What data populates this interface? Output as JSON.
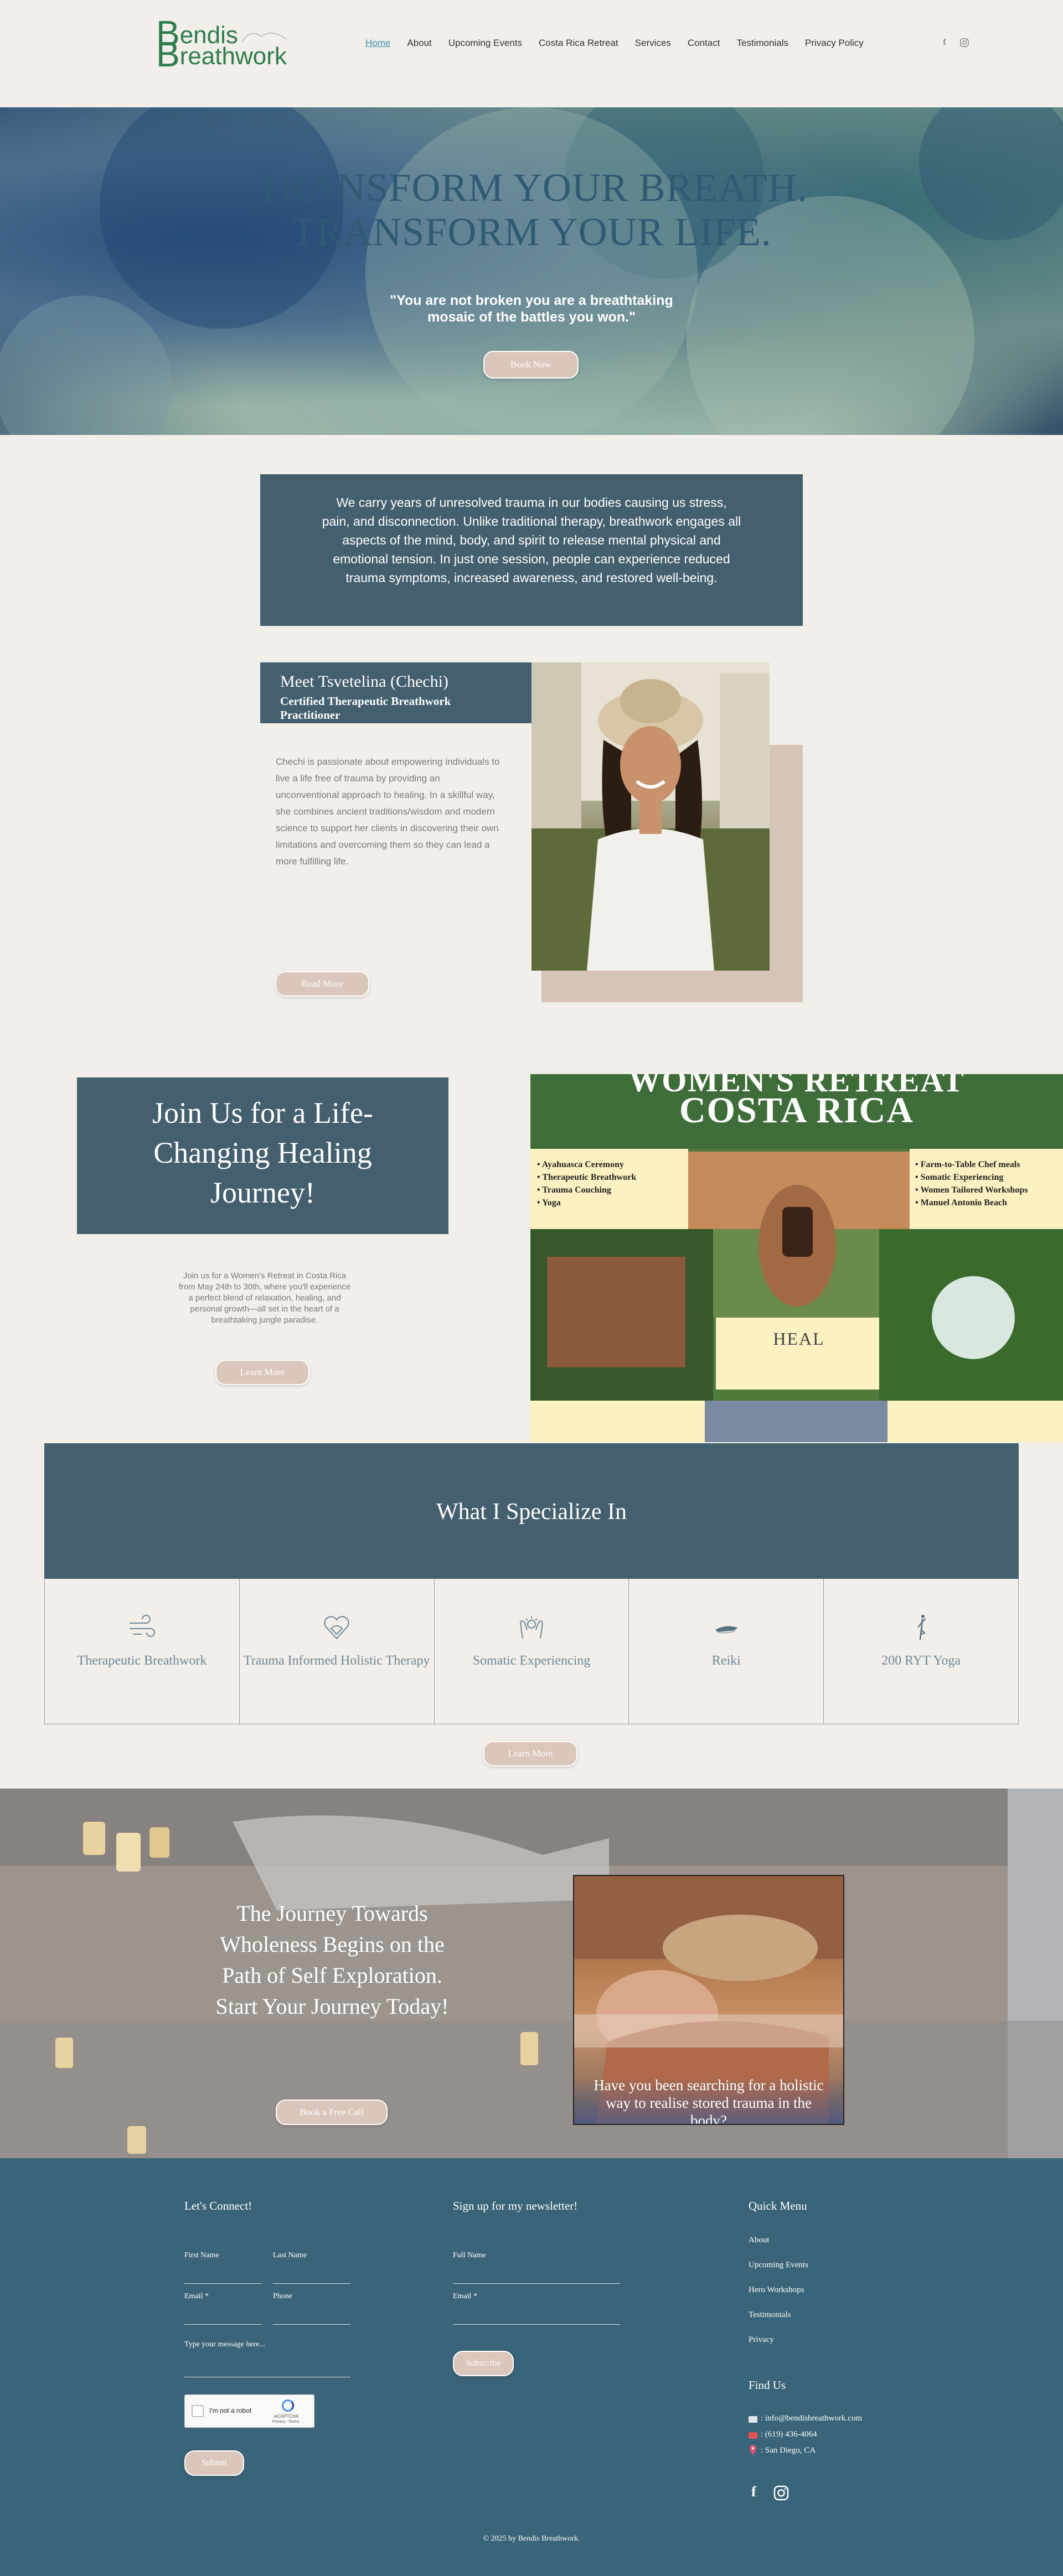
{
  "header": {
    "logo_line1": "endis",
    "logo_line1_initial": "B",
    "logo_line2": "reathwork",
    "logo_line2_initial": "B",
    "nav": [
      "Home",
      "About",
      "Upcoming Events",
      "Costa Rica Retreat",
      "Services",
      "Contact",
      "Testimonials",
      "Privacy Policy"
    ],
    "active_nav": "Home"
  },
  "hero": {
    "title_line1": "TRANSFORM YOUR BREATH.",
    "title_line2": "TRANSFORM YOUR LIFE.",
    "quote": "\"You are not broken you are a breathtaking mosaic of the battles you won.\"",
    "cta": "Book Now"
  },
  "intro": {
    "text": "We carry years of unresolved trauma in our bodies causing us stress, pain, and disconnection. Unlike traditional therapy, breathwork engages all aspects of the mind, body, and spirit to release mental physical and emotional tension. In just one session, people can experience reduced trauma symptoms, increased awareness, and restored well-being."
  },
  "meet": {
    "title": "Meet Tsvetelina (Chechi)",
    "subtitle": "Certified Therapeutic Breathwork Practitioner",
    "bio": "Chechi is passionate about empowering individuals to live a life free of trauma by providing an unconventional approach to healing. In a skillful way, she combines ancient traditions/wisdom and modern science to support her clients in discovering their own limitations and overcoming them so they can lead a more fulfilling life.",
    "cta": "Read More"
  },
  "retreat": {
    "heading": "Join Us for a Life-Changing Healing Journey!",
    "text": "Join us for a Women's Retreat in Costa Rica from May 24th to 30th, where you'll experience a perfect blend of relaxation, healing, and personal growth—all set in the heart of a breathtaking jungle paradise.",
    "cta": "Learn More",
    "poster_title1": "WOMEN'S RETREAT",
    "poster_title2": "COSTA RICA",
    "poster_left": [
      "Ayahuasca Ceremony",
      "Therapeutic Breathwork",
      "Trauma Couching",
      "Yoga"
    ],
    "poster_right": [
      "Farm-to-Table Chef meals",
      "Somatic Experiencing",
      "Women Tailored Workshops",
      "Manuel Antonio Beach"
    ],
    "poster_heal": "HEAL"
  },
  "specialize": {
    "title": "What I Specialize In",
    "items": [
      {
        "label": "Therapeutic Breathwork",
        "icon": "wind-icon"
      },
      {
        "label": "Trauma Informed Holistic Therapy",
        "icon": "heart-hands-icon"
      },
      {
        "label": "Somatic Experiencing",
        "icon": "hands-icon"
      },
      {
        "label": "Reiki",
        "icon": "reiki-hand-icon"
      },
      {
        "label": "200 RYT Yoga",
        "icon": "yoga-pose-icon"
      }
    ],
    "cta": "Learn More"
  },
  "journey": {
    "text": "The Journey Towards Wholeness Begins on the Path of Self Exploration. Start Your Journey Today!",
    "cta": "Book a Free Call",
    "photo_caption": "Have you been searching for a holistic way to realise stored trauma in the body?"
  },
  "footer": {
    "connect_title": "Let's Connect!",
    "first_name": "First Name",
    "last_name": "Last Name",
    "email": "Email *",
    "phone": "Phone",
    "message": "Type your message here...",
    "captcha": "I'm not a robot",
    "captcha_brand": "reCAPTCHA",
    "captcha_terms": "Privacy - Terms",
    "submit": "Submit",
    "newsletter_title": "Sign up for my newsletter!",
    "nl_full_name": "Full Name",
    "nl_email": "Email *",
    "subscribe": "Subscribe",
    "quick_title": "Quick Menu",
    "quick": [
      "About",
      "Upcoming Events",
      "Hero Workshops",
      "Testimonials",
      "Privacy"
    ],
    "find_title": "Find Us",
    "email_value": ":  info@bendisbreathwork.com",
    "phone_value": ":  (619) 436-4064",
    "location_value": ": San Diego, CA",
    "copyright": "© 2025 by Bendis Breathwork."
  }
}
